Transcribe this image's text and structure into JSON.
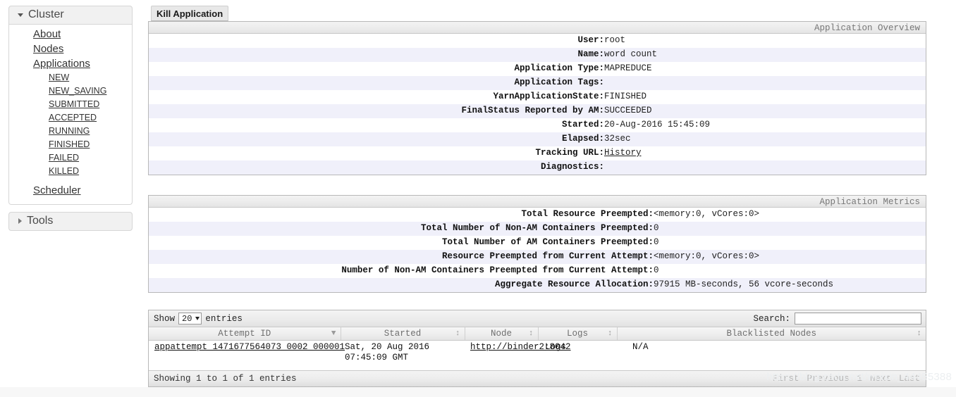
{
  "sidebar": {
    "cluster": {
      "label": "Cluster",
      "expanded": true,
      "items": [
        {
          "label": "About",
          "level": 1
        },
        {
          "label": "Nodes",
          "level": 1
        },
        {
          "label": "Applications",
          "level": 1
        },
        {
          "label": "NEW",
          "level": 2
        },
        {
          "label": "NEW_SAVING",
          "level": 2
        },
        {
          "label": "SUBMITTED",
          "level": 2
        },
        {
          "label": "ACCEPTED",
          "level": 2
        },
        {
          "label": "RUNNING",
          "level": 2
        },
        {
          "label": "FINISHED",
          "level": 2
        },
        {
          "label": "FAILED",
          "level": 2
        },
        {
          "label": "KILLED",
          "level": 2
        },
        {
          "label": "Scheduler",
          "level": 1
        }
      ]
    },
    "tools": {
      "label": "Tools",
      "expanded": false
    }
  },
  "toolbar": {
    "kill_application_label": "Kill Application"
  },
  "overview": {
    "header": "Application Overview",
    "rows": [
      {
        "key": "User:",
        "value": "root",
        "link": false
      },
      {
        "key": "Name:",
        "value": "word count",
        "link": false
      },
      {
        "key": "Application Type:",
        "value": "MAPREDUCE",
        "link": false
      },
      {
        "key": "Application Tags:",
        "value": "",
        "link": false
      },
      {
        "key": "YarnApplicationState:",
        "value": "FINISHED",
        "link": false
      },
      {
        "key": "FinalStatus Reported by AM:",
        "value": "SUCCEEDED",
        "link": false
      },
      {
        "key": "Started:",
        "value": "20-Aug-2016 15:45:09",
        "link": false
      },
      {
        "key": "Elapsed:",
        "value": "32sec",
        "link": false
      },
      {
        "key": "Tracking URL:",
        "value": "History",
        "link": true
      },
      {
        "key": "Diagnostics:",
        "value": "",
        "link": false
      }
    ]
  },
  "metrics": {
    "header": "Application Metrics",
    "rows": [
      {
        "key": "Total Resource Preempted:",
        "value": "<memory:0, vCores:0>"
      },
      {
        "key": "Total Number of Non-AM Containers Preempted:",
        "value": "0"
      },
      {
        "key": "Total Number of AM Containers Preempted:",
        "value": "0"
      },
      {
        "key": "Resource Preempted from Current Attempt:",
        "value": "<memory:0, vCores:0>"
      },
      {
        "key": "Number of Non-AM Containers Preempted from Current Attempt:",
        "value": "0"
      },
      {
        "key": "Aggregate Resource Allocation:",
        "value": "97915 MB-seconds, 56 vcore-seconds"
      }
    ]
  },
  "attempts_table": {
    "show_label": "Show",
    "page_length": "20",
    "entries_label": "entries",
    "search_label": "Search:",
    "search_value": "",
    "search_placeholder": "",
    "columns": [
      {
        "label": "Attempt ID",
        "sort": "desc"
      },
      {
        "label": "Started",
        "sort": "none"
      },
      {
        "label": "Node",
        "sort": "none"
      },
      {
        "label": "Logs",
        "sort": "none"
      },
      {
        "label": "Blacklisted Nodes",
        "sort": "none"
      }
    ],
    "rows": [
      {
        "attempt_id": "appattempt_1471677564073_0002_000001",
        "started": "Sat, 20 Aug 2016 07:45:09 GMT",
        "node": "http://binder2:8042",
        "logs": "Logs",
        "blacklisted_nodes": "N/A"
      }
    ],
    "info": "Showing 1 to 1 of 1 entries",
    "pagination": [
      "First",
      "Previous",
      "1",
      "Next",
      "Last"
    ]
  },
  "watermark": "https://blog.csdn.net/weixin_44455388"
}
